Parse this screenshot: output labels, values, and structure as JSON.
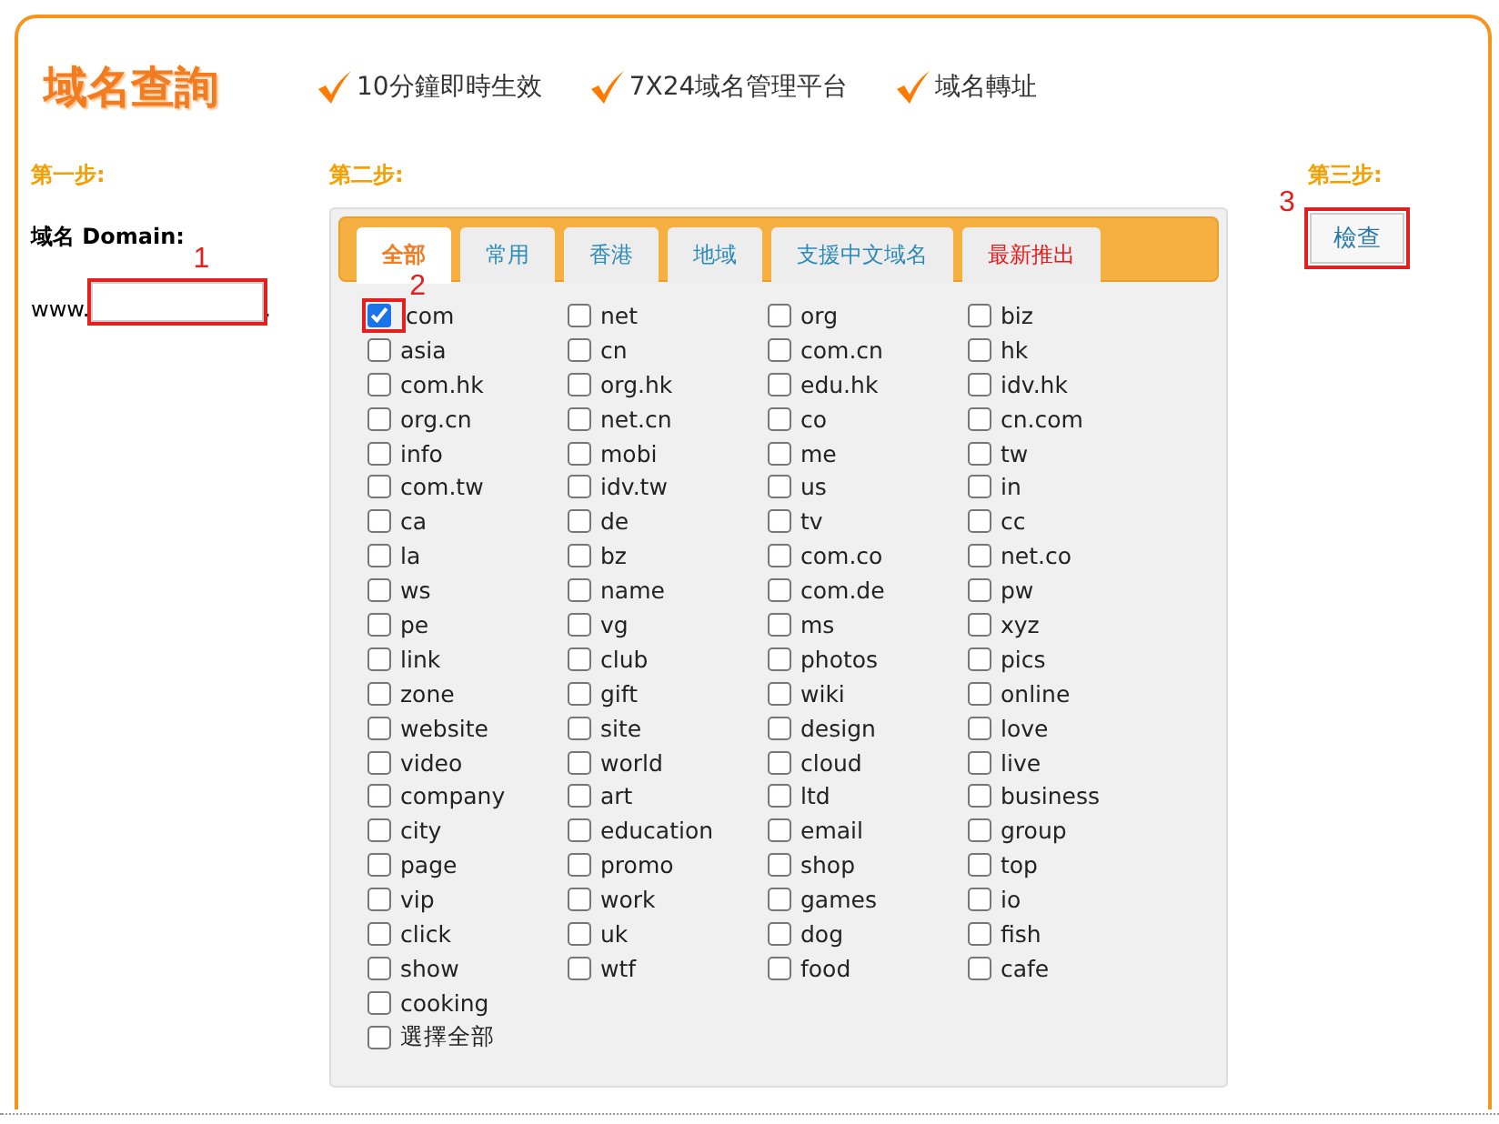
{
  "header": {
    "title": "域名查詢",
    "features": [
      "10分鐘即時生效",
      "7X24域名管理平台",
      "域名轉址"
    ]
  },
  "step1": {
    "label": "第一步:",
    "domain_label": "域名 Domain:",
    "prefix": "www.",
    "suffix": ".",
    "field_callout": "1"
  },
  "step2": {
    "label": "第二步:",
    "tabs": [
      {
        "label": "全部",
        "selected": true,
        "highlight": false
      },
      {
        "label": "常用",
        "selected": false,
        "highlight": false
      },
      {
        "label": "香港",
        "selected": false,
        "highlight": false
      },
      {
        "label": "地域",
        "selected": false,
        "highlight": false
      },
      {
        "label": "支援中文域名",
        "selected": false,
        "highlight": false
      },
      {
        "label": "最新推出",
        "selected": false,
        "highlight": true
      }
    ],
    "first_callout": "2",
    "options": [
      {
        "label": "com",
        "checked": true
      },
      {
        "label": "net",
        "checked": false
      },
      {
        "label": "org",
        "checked": false
      },
      {
        "label": "biz",
        "checked": false
      },
      {
        "label": "asia",
        "checked": false
      },
      {
        "label": "cn",
        "checked": false
      },
      {
        "label": "com.cn",
        "checked": false
      },
      {
        "label": "hk",
        "checked": false
      },
      {
        "label": "com.hk",
        "checked": false
      },
      {
        "label": "org.hk",
        "checked": false
      },
      {
        "label": "edu.hk",
        "checked": false
      },
      {
        "label": "idv.hk",
        "checked": false
      },
      {
        "label": "org.cn",
        "checked": false
      },
      {
        "label": "net.cn",
        "checked": false
      },
      {
        "label": "co",
        "checked": false
      },
      {
        "label": "cn.com",
        "checked": false
      },
      {
        "label": "info",
        "checked": false
      },
      {
        "label": "mobi",
        "checked": false
      },
      {
        "label": "me",
        "checked": false
      },
      {
        "label": "tw",
        "checked": false
      },
      {
        "label": "com.tw",
        "checked": false
      },
      {
        "label": "idv.tw",
        "checked": false
      },
      {
        "label": "us",
        "checked": false
      },
      {
        "label": "in",
        "checked": false
      },
      {
        "label": "ca",
        "checked": false
      },
      {
        "label": "de",
        "checked": false
      },
      {
        "label": "tv",
        "checked": false
      },
      {
        "label": "cc",
        "checked": false
      },
      {
        "label": "la",
        "checked": false
      },
      {
        "label": "bz",
        "checked": false
      },
      {
        "label": "com.co",
        "checked": false
      },
      {
        "label": "net.co",
        "checked": false
      },
      {
        "label": "ws",
        "checked": false
      },
      {
        "label": "name",
        "checked": false
      },
      {
        "label": "com.de",
        "checked": false
      },
      {
        "label": "pw",
        "checked": false
      },
      {
        "label": "pe",
        "checked": false
      },
      {
        "label": "vg",
        "checked": false
      },
      {
        "label": "ms",
        "checked": false
      },
      {
        "label": "xyz",
        "checked": false
      },
      {
        "label": "link",
        "checked": false
      },
      {
        "label": "club",
        "checked": false
      },
      {
        "label": "photos",
        "checked": false
      },
      {
        "label": "pics",
        "checked": false
      },
      {
        "label": "zone",
        "checked": false
      },
      {
        "label": "gift",
        "checked": false
      },
      {
        "label": "wiki",
        "checked": false
      },
      {
        "label": "online",
        "checked": false
      },
      {
        "label": "website",
        "checked": false
      },
      {
        "label": "site",
        "checked": false
      },
      {
        "label": "design",
        "checked": false
      },
      {
        "label": "love",
        "checked": false
      },
      {
        "label": "video",
        "checked": false
      },
      {
        "label": "world",
        "checked": false
      },
      {
        "label": "cloud",
        "checked": false
      },
      {
        "label": "live",
        "checked": false
      },
      {
        "label": "company",
        "checked": false
      },
      {
        "label": "art",
        "checked": false
      },
      {
        "label": "ltd",
        "checked": false
      },
      {
        "label": "business",
        "checked": false
      },
      {
        "label": "city",
        "checked": false
      },
      {
        "label": "education",
        "checked": false
      },
      {
        "label": "email",
        "checked": false
      },
      {
        "label": "group",
        "checked": false
      },
      {
        "label": "page",
        "checked": false
      },
      {
        "label": "promo",
        "checked": false
      },
      {
        "label": "shop",
        "checked": false
      },
      {
        "label": "top",
        "checked": false
      },
      {
        "label": "vip",
        "checked": false
      },
      {
        "label": "work",
        "checked": false
      },
      {
        "label": "games",
        "checked": false
      },
      {
        "label": "io",
        "checked": false
      },
      {
        "label": "click",
        "checked": false
      },
      {
        "label": "uk",
        "checked": false
      },
      {
        "label": "dog",
        "checked": false
      },
      {
        "label": "fish",
        "checked": false
      },
      {
        "label": "show",
        "checked": false
      },
      {
        "label": "wtf",
        "checked": false
      },
      {
        "label": "food",
        "checked": false
      },
      {
        "label": "cafe",
        "checked": false
      },
      {
        "label": "cooking",
        "checked": false
      }
    ],
    "select_all": {
      "label": "選擇全部",
      "checked": false
    }
  },
  "step3": {
    "label": "第三步:",
    "button": "檢查",
    "button_callout": "3"
  }
}
